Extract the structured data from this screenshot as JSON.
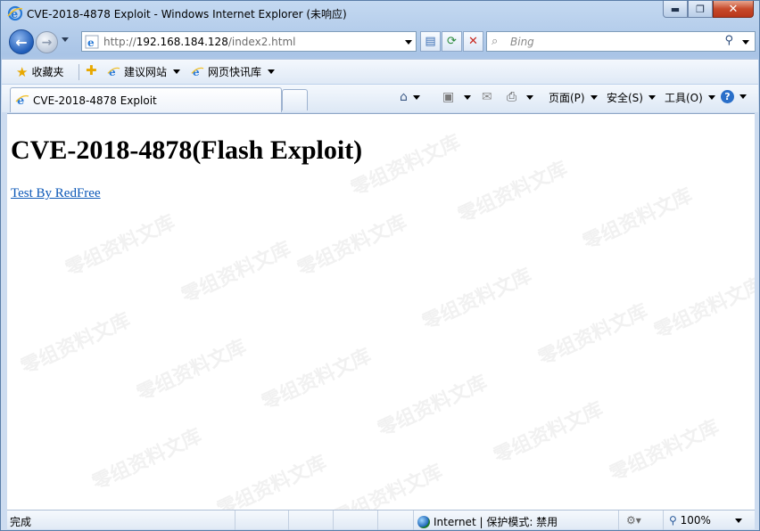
{
  "window": {
    "title": "CVE-2018-4878 Exploit - Windows Internet Explorer (未响应)",
    "min_label": "▬",
    "max_label": "❐",
    "close_label": "✕"
  },
  "nav": {
    "address_prefix": "http://",
    "address_host": "192.168.184.128",
    "address_path": "/index2.html",
    "search_placeholder": "Bing"
  },
  "favorites": {
    "label": "收藏夹",
    "items": [
      {
        "label": "建议网站",
        "icon": "ie-icon"
      },
      {
        "label": "网页快讯库",
        "icon": "ie-icon"
      }
    ]
  },
  "tabs": [
    {
      "label": "CVE-2018-4878 Exploit",
      "active": true
    }
  ],
  "command_bar": {
    "page_label": "页面(P)",
    "safety_label": "安全(S)",
    "tools_label": "工具(O)",
    "help_label": "?"
  },
  "page": {
    "heading": "CVE-2018-4878(Flash Exploit)",
    "link_text": "Test By RedFree"
  },
  "status": {
    "left_text": "完成",
    "zone_text": "Internet | 保护模式: 禁用",
    "zoom_text": "100%"
  },
  "watermark": {
    "text": "零组资料文库"
  }
}
